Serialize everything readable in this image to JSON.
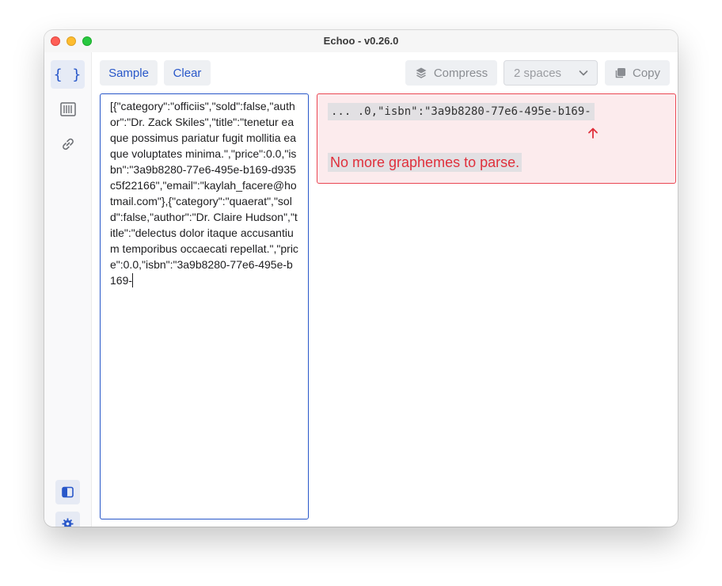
{
  "window": {
    "title": "Echoo - v0.26.0"
  },
  "sidebar": {
    "items": [
      {
        "icon": "braces-icon",
        "glyph": "{ }",
        "active": true
      },
      {
        "icon": "barcode-icon",
        "active": false
      },
      {
        "icon": "link-icon",
        "active": false
      }
    ],
    "bottom": [
      {
        "icon": "panel-toggle-icon"
      },
      {
        "icon": "gear-icon"
      }
    ]
  },
  "toolbar": {
    "sample_label": "Sample",
    "clear_label": "Clear",
    "compress_label": "Compress",
    "indent_value": "2 spaces",
    "copy_label": "Copy"
  },
  "editor": {
    "text": "[{\"category\":\"officiis\",\"sold\":false,\"author\":\"Dr. Zack Skiles\",\"title\":\"tenetur eaque possimus pariatur fugit mollitia eaque voluptates minima.\",\"price\":0.0,\"isbn\":\"3a9b8280-77e6-495e-b169-d935c5f22166\",\"email\":\"kaylah_facere@hotmail.com\"},{\"category\":\"quaerat\",\"sold\":false,\"author\":\"Dr. Claire Hudson\",\"title\":\"delectus dolor itaque accusantium temporibus occaecati repellat.\",\"price\":0.0,\"isbn\":\"3a9b8280-77e6-495e-b169-"
  },
  "error": {
    "snippet": "... .0,\"isbn\":\"3a9b8280-77e6-495e-b169-",
    "message": "No more graphemes to parse."
  },
  "colors": {
    "accent": "#2857c9",
    "error": "#e0303c",
    "error_bg": "#fcebed"
  }
}
